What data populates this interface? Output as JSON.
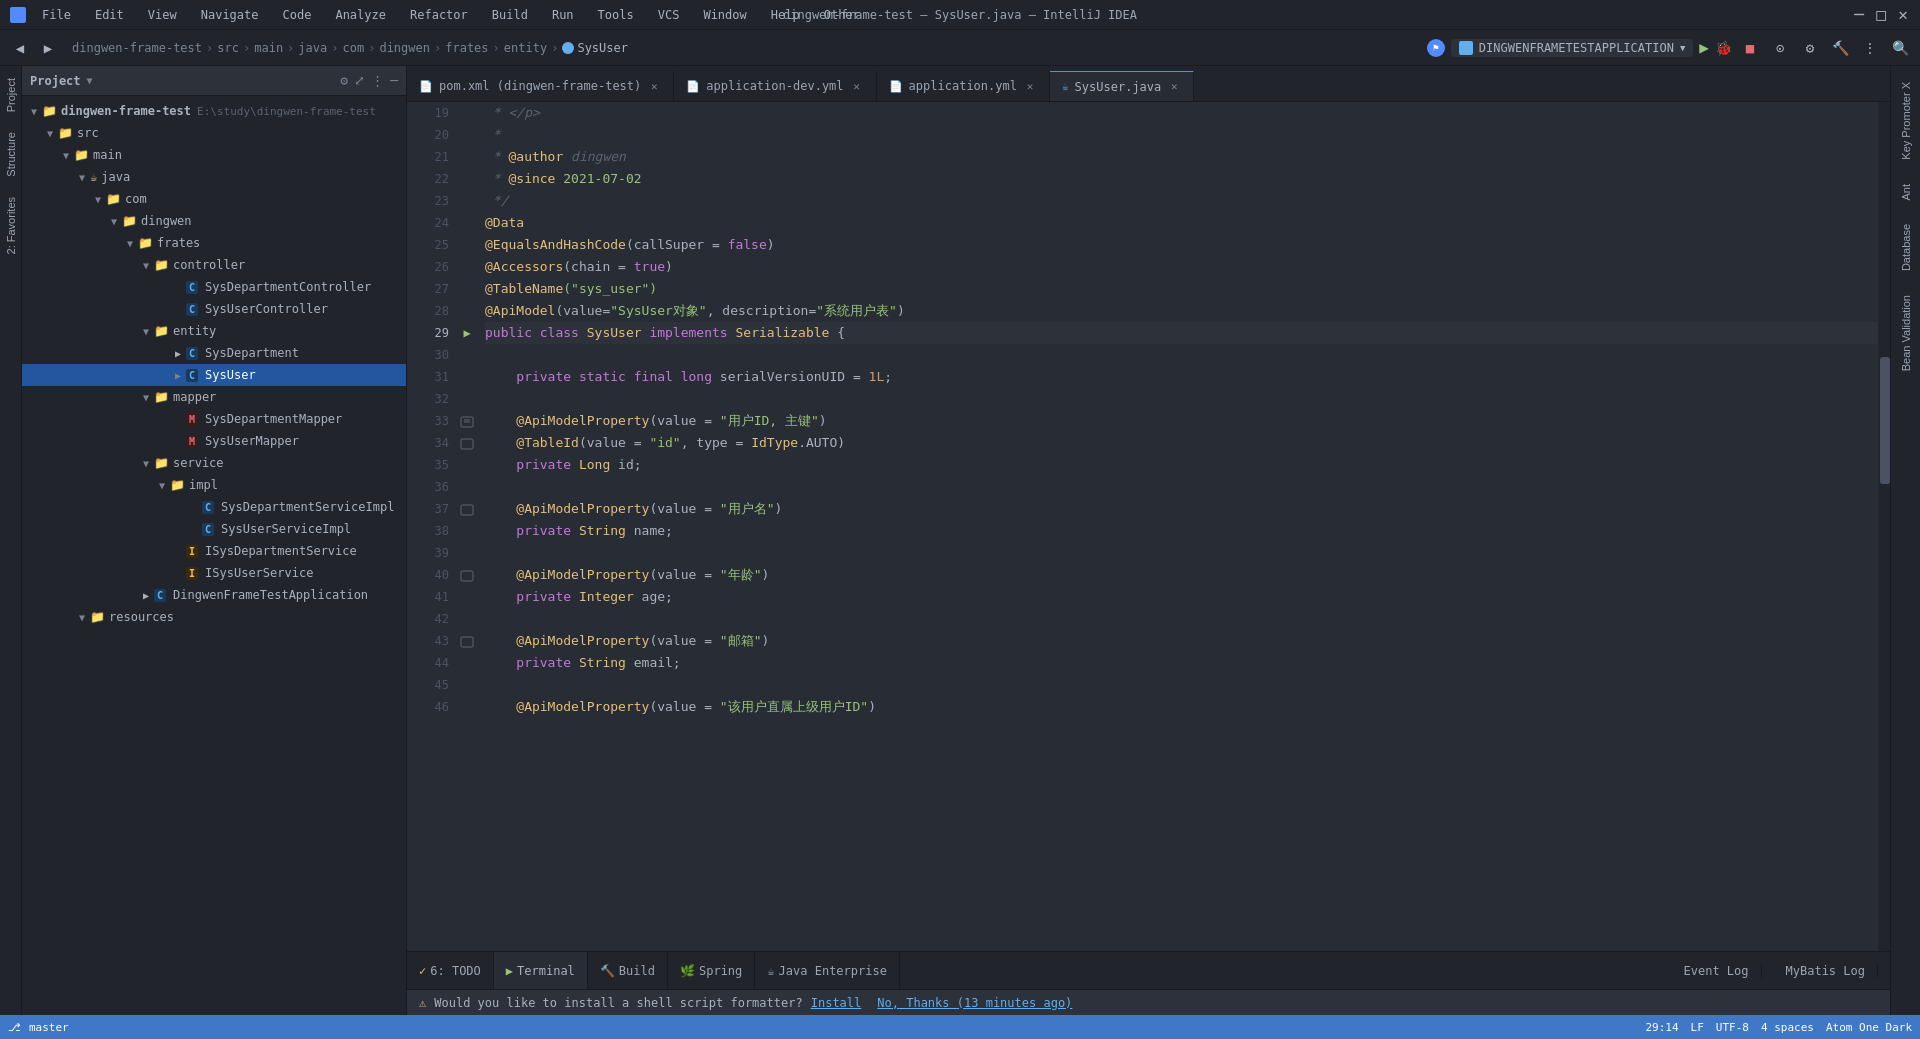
{
  "titleBar": {
    "appName": "dingwen-frame-test – SysUser.java – IntelliJ IDEA",
    "menus": [
      "File",
      "Edit",
      "View",
      "Navigate",
      "Code",
      "Analyze",
      "Refactor",
      "Build",
      "Run",
      "Tools",
      "VCS",
      "Window",
      "Help",
      "Other"
    ]
  },
  "breadcrumb": {
    "parts": [
      "dingwen-frame-test",
      "src",
      "main",
      "java",
      "com",
      "dingwen",
      "frates",
      "entity",
      "SysUser"
    ]
  },
  "runConfig": {
    "name": "DINGWENFRAMETESTAPPLICATION"
  },
  "tabs": [
    {
      "label": "pom.xml (dingwen-frame-test)",
      "type": "xml",
      "active": false
    },
    {
      "label": "application-dev.yml",
      "type": "yml",
      "active": false
    },
    {
      "label": "application.yml",
      "type": "yml",
      "active": false
    },
    {
      "label": "SysUser.java",
      "type": "java",
      "active": true
    }
  ],
  "projectTree": {
    "rootLabel": "Project",
    "items": [
      {
        "indent": 0,
        "arrow": "▼",
        "icon": "📁",
        "iconClass": "folder-icon",
        "label": "dingwen-frame-test E:\\study\\dingwen-frame-test",
        "type": "root"
      },
      {
        "indent": 1,
        "arrow": "▼",
        "icon": "📁",
        "iconClass": "folder-icon",
        "label": "src",
        "type": "folder"
      },
      {
        "indent": 2,
        "arrow": "▼",
        "icon": "📁",
        "iconClass": "folder-icon",
        "label": "main",
        "type": "folder"
      },
      {
        "indent": 3,
        "arrow": "▼",
        "icon": "☕",
        "iconClass": "java-icon",
        "label": "java",
        "type": "folder"
      },
      {
        "indent": 4,
        "arrow": "▼",
        "icon": "📁",
        "iconClass": "folder-icon",
        "label": "com",
        "type": "folder"
      },
      {
        "indent": 5,
        "arrow": "▼",
        "icon": "📁",
        "iconClass": "folder-icon",
        "label": "dingwen",
        "type": "folder"
      },
      {
        "indent": 6,
        "arrow": "▼",
        "icon": "📁",
        "iconClass": "folder-icon",
        "label": "frates",
        "type": "folder"
      },
      {
        "indent": 7,
        "arrow": "▼",
        "icon": "📁",
        "iconClass": "folder-icon-blue",
        "label": "controller",
        "type": "folder"
      },
      {
        "indent": 8,
        "arrow": " ",
        "icon": "C",
        "iconClass": "class-icon-c",
        "label": "SysDepartmentController",
        "type": "class"
      },
      {
        "indent": 8,
        "arrow": " ",
        "icon": "C",
        "iconClass": "class-icon-c",
        "label": "SysUserController",
        "type": "class"
      },
      {
        "indent": 7,
        "arrow": "▼",
        "icon": "📁",
        "iconClass": "folder-icon-blue",
        "label": "entity",
        "type": "folder"
      },
      {
        "indent": 8,
        "arrow": "▶",
        "icon": "C",
        "iconClass": "class-icon-c",
        "label": "SysDepartment",
        "type": "class"
      },
      {
        "indent": 8,
        "arrow": "▶",
        "icon": "C",
        "iconClass": "class-icon-c",
        "label": "SysUser",
        "type": "class",
        "selected": true
      },
      {
        "indent": 7,
        "arrow": "▼",
        "icon": "📁",
        "iconClass": "folder-icon-blue",
        "label": "mapper",
        "type": "folder"
      },
      {
        "indent": 8,
        "arrow": " ",
        "icon": "M",
        "iconClass": "mapper-icon",
        "label": "SysDepartmentMapper",
        "type": "mapper"
      },
      {
        "indent": 8,
        "arrow": " ",
        "icon": "M",
        "iconClass": "mapper-icon",
        "label": "SysUserMapper",
        "type": "mapper"
      },
      {
        "indent": 7,
        "arrow": "▼",
        "icon": "📁",
        "iconClass": "folder-icon-blue",
        "label": "service",
        "type": "folder"
      },
      {
        "indent": 8,
        "arrow": "▼",
        "icon": "📁",
        "iconClass": "folder-icon-blue",
        "label": "impl",
        "type": "folder"
      },
      {
        "indent": 9,
        "arrow": " ",
        "icon": "C",
        "iconClass": "class-icon-c",
        "label": "SysDepartmentServiceImpl",
        "type": "class"
      },
      {
        "indent": 9,
        "arrow": " ",
        "icon": "C",
        "iconClass": "class-icon-c",
        "label": "SysUserServiceImpl",
        "type": "class"
      },
      {
        "indent": 8,
        "arrow": " ",
        "icon": "I",
        "iconClass": "class-icon-i",
        "label": "ISysDepartmentService",
        "type": "interface"
      },
      {
        "indent": 8,
        "arrow": " ",
        "icon": "I",
        "iconClass": "class-icon-i",
        "label": "ISysUserService",
        "type": "interface"
      },
      {
        "indent": 7,
        "arrow": "▶",
        "icon": "C",
        "iconClass": "class-icon-c",
        "label": "DingwenFrameTestApplication",
        "type": "class"
      },
      {
        "indent": 6,
        "arrow": "▼",
        "icon": "📁",
        "iconClass": "folder-icon",
        "label": "resources",
        "type": "folder"
      }
    ]
  },
  "codeLines": [
    {
      "num": 19,
      "tokens": [
        {
          "t": " * ",
          "c": "cmt"
        },
        {
          "t": "</p>",
          "c": "cmt"
        }
      ]
    },
    {
      "num": 20,
      "tokens": [
        {
          "t": " *",
          "c": "cmt"
        }
      ]
    },
    {
      "num": 21,
      "tokens": [
        {
          "t": " * ",
          "c": "cmt"
        },
        {
          "t": "@author",
          "c": "ann"
        },
        {
          "t": " dingwen",
          "c": "cmt"
        }
      ]
    },
    {
      "num": 22,
      "tokens": [
        {
          "t": " * ",
          "c": "cmt"
        },
        {
          "t": "@since",
          "c": "ann"
        },
        {
          "t": " 2021-07-02",
          "c": "since-val"
        }
      ]
    },
    {
      "num": 23,
      "tokens": [
        {
          "t": " */",
          "c": "cmt"
        }
      ]
    },
    {
      "num": 24,
      "tokens": [
        {
          "t": "@Data",
          "c": "ann"
        }
      ]
    },
    {
      "num": 25,
      "tokens": [
        {
          "t": "@EqualsAndHashCode",
          "c": "ann"
        },
        {
          "t": "(callSuper = ",
          "c": "plain"
        },
        {
          "t": "false",
          "c": "kw"
        },
        {
          "t": ")",
          "c": "plain"
        }
      ]
    },
    {
      "num": 26,
      "tokens": [
        {
          "t": "@Accessors",
          "c": "ann"
        },
        {
          "t": "(chain = ",
          "c": "plain"
        },
        {
          "t": "true",
          "c": "kw"
        },
        {
          "t": ")",
          "c": "plain"
        }
      ]
    },
    {
      "num": 27,
      "tokens": [
        {
          "t": "@TableName",
          "c": "ann"
        },
        {
          "t": "(\"sys_user\")",
          "c": "str"
        }
      ]
    },
    {
      "num": 28,
      "tokens": [
        {
          "t": "@ApiModel",
          "c": "ann"
        },
        {
          "t": "(value=",
          "c": "plain"
        },
        {
          "t": "\"SysUser对象\"",
          "c": "str"
        },
        {
          "t": ", description=",
          "c": "plain"
        },
        {
          "t": "\"系统用户表\"",
          "c": "str"
        },
        {
          "t": ")",
          "c": "plain"
        }
      ]
    },
    {
      "num": 29,
      "tokens": [
        {
          "t": "public",
          "c": "kw"
        },
        {
          "t": " ",
          "c": "plain"
        },
        {
          "t": "class",
          "c": "kw"
        },
        {
          "t": " ",
          "c": "plain"
        },
        {
          "t": "SysUser",
          "c": "type"
        },
        {
          "t": " ",
          "c": "plain"
        },
        {
          "t": "implements",
          "c": "kw"
        },
        {
          "t": " ",
          "c": "plain"
        },
        {
          "t": "Serializable",
          "c": "type"
        },
        {
          "t": " {",
          "c": "plain"
        }
      ]
    },
    {
      "num": 30,
      "tokens": []
    },
    {
      "num": 31,
      "tokens": [
        {
          "t": "    ",
          "c": "plain"
        },
        {
          "t": "private",
          "c": "kw"
        },
        {
          "t": " ",
          "c": "plain"
        },
        {
          "t": "static",
          "c": "kw"
        },
        {
          "t": " ",
          "c": "plain"
        },
        {
          "t": "final",
          "c": "kw"
        },
        {
          "t": " ",
          "c": "plain"
        },
        {
          "t": "long",
          "c": "kw"
        },
        {
          "t": " serialVersionUID = ",
          "c": "plain"
        },
        {
          "t": "1L",
          "c": "num"
        },
        {
          "t": ";",
          "c": "plain"
        }
      ]
    },
    {
      "num": 32,
      "tokens": []
    },
    {
      "num": 33,
      "tokens": [
        {
          "t": "    ",
          "c": "plain"
        },
        {
          "t": "@ApiModelProperty",
          "c": "ann"
        },
        {
          "t": "(value = ",
          "c": "plain"
        },
        {
          "t": "\"用户ID, 主键\"",
          "c": "str"
        },
        {
          "t": ")",
          "c": "plain"
        }
      ]
    },
    {
      "num": 34,
      "tokens": [
        {
          "t": "    ",
          "c": "plain"
        },
        {
          "t": "@TableId",
          "c": "ann"
        },
        {
          "t": "(value = ",
          "c": "plain"
        },
        {
          "t": "\"id\"",
          "c": "str"
        },
        {
          "t": ", type = ",
          "c": "plain"
        },
        {
          "t": "IdType",
          "c": "type"
        },
        {
          "t": ".AUTO)",
          "c": "plain"
        }
      ]
    },
    {
      "num": 35,
      "tokens": [
        {
          "t": "    ",
          "c": "plain"
        },
        {
          "t": "private",
          "c": "kw"
        },
        {
          "t": " ",
          "c": "plain"
        },
        {
          "t": "Long",
          "c": "type"
        },
        {
          "t": " id;",
          "c": "plain"
        }
      ]
    },
    {
      "num": 36,
      "tokens": []
    },
    {
      "num": 37,
      "tokens": [
        {
          "t": "    ",
          "c": "plain"
        },
        {
          "t": "@ApiModelProperty",
          "c": "ann"
        },
        {
          "t": "(value = ",
          "c": "plain"
        },
        {
          "t": "\"用户名\"",
          "c": "str"
        },
        {
          "t": ")",
          "c": "plain"
        }
      ]
    },
    {
      "num": 38,
      "tokens": [
        {
          "t": "    ",
          "c": "plain"
        },
        {
          "t": "private",
          "c": "kw"
        },
        {
          "t": " ",
          "c": "plain"
        },
        {
          "t": "String",
          "c": "type"
        },
        {
          "t": " name;",
          "c": "plain"
        }
      ]
    },
    {
      "num": 39,
      "tokens": []
    },
    {
      "num": 40,
      "tokens": [
        {
          "t": "    ",
          "c": "plain"
        },
        {
          "t": "@ApiModelProperty",
          "c": "ann"
        },
        {
          "t": "(value = ",
          "c": "plain"
        },
        {
          "t": "\"年龄\"",
          "c": "str"
        },
        {
          "t": ")",
          "c": "plain"
        }
      ]
    },
    {
      "num": 41,
      "tokens": [
        {
          "t": "    ",
          "c": "plain"
        },
        {
          "t": "private",
          "c": "kw"
        },
        {
          "t": " ",
          "c": "plain"
        },
        {
          "t": "Integer",
          "c": "type"
        },
        {
          "t": " age;",
          "c": "plain"
        }
      ]
    },
    {
      "num": 42,
      "tokens": []
    },
    {
      "num": 43,
      "tokens": [
        {
          "t": "    ",
          "c": "plain"
        },
        {
          "t": "@ApiModelProperty",
          "c": "ann"
        },
        {
          "t": "(value = ",
          "c": "plain"
        },
        {
          "t": "\"邮箱\"",
          "c": "str"
        },
        {
          "t": ")",
          "c": "plain"
        }
      ]
    },
    {
      "num": 44,
      "tokens": [
        {
          "t": "    ",
          "c": "plain"
        },
        {
          "t": "private",
          "c": "kw"
        },
        {
          "t": " ",
          "c": "plain"
        },
        {
          "t": "String",
          "c": "type"
        },
        {
          "t": " email;",
          "c": "plain"
        }
      ]
    },
    {
      "num": 45,
      "tokens": []
    },
    {
      "num": 46,
      "tokens": [
        {
          "t": "    ",
          "c": "plain"
        },
        {
          "t": "@ApiModelProperty",
          "c": "ann"
        },
        {
          "t": "(value = ",
          "c": "plain"
        },
        {
          "t": "\"该用户直属上级用户ID\"",
          "c": "str"
        },
        {
          "t": ")",
          "c": "plain"
        }
      ]
    }
  ],
  "statusBar": {
    "position": "29:14",
    "lineEnding": "LF",
    "encoding": "UTF-8",
    "indent": "4 spaces",
    "theme": "Atom One Dark"
  },
  "bottomTabs": [
    {
      "label": "6: TODO",
      "icon": "✓"
    },
    {
      "label": "Terminal",
      "icon": "▶"
    },
    {
      "label": "Build",
      "icon": "🔨"
    },
    {
      "label": "Spring",
      "icon": "🌿"
    },
    {
      "label": "Java Enterprise",
      "icon": "☕"
    }
  ],
  "notification": {
    "text": "Would you like to install a shell script formatter?",
    "installLink": "Install",
    "dismissLink": "No, Thanks (13 minutes ago)"
  },
  "rightPanels": [
    {
      "label": "Key Promoter X"
    },
    {
      "label": "Ant"
    },
    {
      "label": "Database"
    },
    {
      "label": "Bean Validation"
    }
  ],
  "eventLog": "Event Log",
  "mybatisLog": "MyBatis Log"
}
